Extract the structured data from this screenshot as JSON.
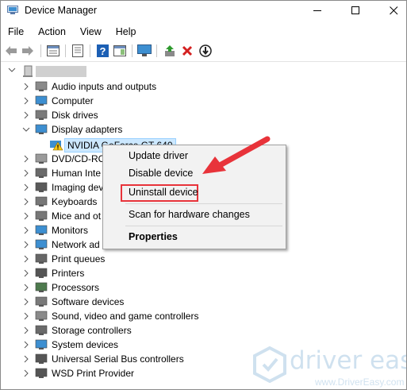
{
  "window": {
    "title": "Device Manager",
    "controls": {
      "minimize": "—",
      "maximize": "☐",
      "close": "✕"
    }
  },
  "menu": [
    "File",
    "Action",
    "View",
    "Help"
  ],
  "toolbar": [
    "back-arrow-icon",
    "forward-arrow-icon",
    "properties-icon",
    "show-hide-icon",
    "help-icon",
    "action-pane-icon",
    "monitor-icon",
    "update-driver-icon",
    "uninstall-x-icon",
    "download-icon"
  ],
  "tree": {
    "nodes": [
      {
        "label": "Audio inputs and outputs",
        "icon": "speaker-icon",
        "expanded": false
      },
      {
        "label": "Computer",
        "icon": "computer-icon",
        "expanded": false
      },
      {
        "label": "Disk drives",
        "icon": "disk-drive-icon",
        "expanded": false
      },
      {
        "label": "Display adapters",
        "icon": "display-adapter-icon",
        "expanded": true
      },
      {
        "label": "DVD/CD-RC",
        "icon": "dvd-icon",
        "expanded": false
      },
      {
        "label": "Human Inte",
        "icon": "hid-icon",
        "expanded": false
      },
      {
        "label": "Imaging dev",
        "icon": "camera-icon",
        "expanded": false
      },
      {
        "label": "Keyboards",
        "icon": "keyboard-icon",
        "expanded": false
      },
      {
        "label": "Mice and ot",
        "icon": "mouse-icon",
        "expanded": false
      },
      {
        "label": "Monitors",
        "icon": "monitor-icon",
        "expanded": false
      },
      {
        "label": "Network ad",
        "icon": "network-icon",
        "expanded": false
      },
      {
        "label": "Print queues",
        "icon": "print-queue-icon",
        "expanded": false
      },
      {
        "label": "Printers",
        "icon": "printer-icon",
        "expanded": false
      },
      {
        "label": "Processors",
        "icon": "processor-icon",
        "expanded": false
      },
      {
        "label": "Software devices",
        "icon": "software-device-icon",
        "expanded": false
      },
      {
        "label": "Sound, video and game controllers",
        "icon": "sound-icon",
        "expanded": false
      },
      {
        "label": "Storage controllers",
        "icon": "storage-icon",
        "expanded": false
      },
      {
        "label": "System devices",
        "icon": "system-device-icon",
        "expanded": false
      },
      {
        "label": "Universal Serial Bus controllers",
        "icon": "usb-icon",
        "expanded": false
      },
      {
        "label": "WSD Print Provider",
        "icon": "wsd-icon",
        "expanded": false
      }
    ],
    "child": {
      "label": "NVIDIA GeForce GT 640",
      "icon": "warning-icon"
    }
  },
  "context_menu": {
    "items": [
      "Update driver",
      "Disable device",
      "Uninstall device",
      "Scan for hardware changes",
      "Properties"
    ],
    "highlighted": "Uninstall device",
    "accent": "#e8333a"
  },
  "watermark": {
    "brand": "driver easy",
    "url": "www.DriverEasy.com"
  },
  "colors": {
    "selection_bg": "#cce8ff",
    "annotation_red": "#e8333a",
    "help_blue": "#1c5fb4"
  }
}
